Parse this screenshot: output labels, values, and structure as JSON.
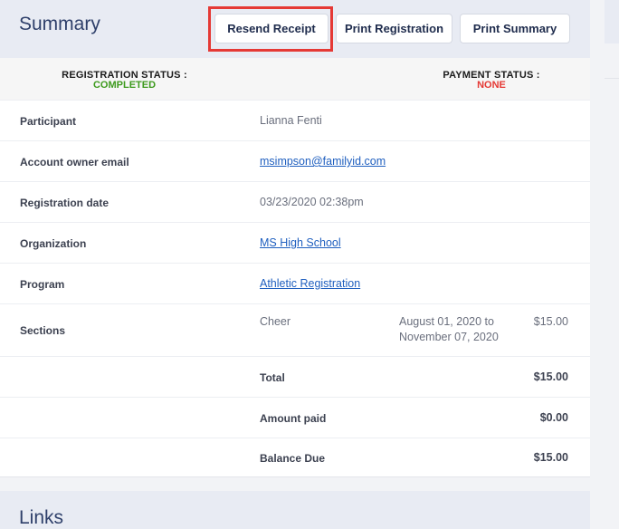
{
  "summary": {
    "title": "Summary",
    "buttons": {
      "resend_receipt": "Resend Receipt",
      "print_registration": "Print Registration",
      "print_summary": "Print Summary"
    },
    "highlight_color": "#e53935"
  },
  "status": {
    "registration_label": "REGISTRATION STATUS :",
    "registration_value": "COMPLETED",
    "registration_color": "#3d9a1d",
    "payment_label": "PAYMENT STATUS :",
    "payment_value": "NONE",
    "payment_color": "#e53935"
  },
  "details": {
    "participant_label": "Participant",
    "participant_value": "Lianna Fenti",
    "email_label": "Account owner email",
    "email_value": "msimpson@familyid.com",
    "date_label": "Registration date",
    "date_value": "03/23/2020 02:38pm",
    "organization_label": "Organization",
    "organization_value": "MS High School",
    "program_label": "Program",
    "program_value": "Athletic Registration",
    "sections_label": "Sections",
    "section_name": "Cheer",
    "section_dates_line1": "August 01, 2020 to",
    "section_dates_line2": "November 07, 2020",
    "section_amount": "$15.00"
  },
  "totals": {
    "total_label": "Total",
    "total_value": "$15.00",
    "amount_paid_label": "Amount paid",
    "amount_paid_value": "$0.00",
    "balance_due_label": "Balance Due",
    "balance_due_value": "$15.00"
  },
  "links": {
    "title": "Links"
  }
}
